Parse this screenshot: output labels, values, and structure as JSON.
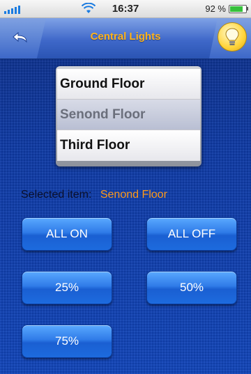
{
  "status_bar": {
    "time": "16:37",
    "battery_text": "92 %",
    "battery_level": 0.92
  },
  "nav": {
    "title": "Central Lights"
  },
  "picker": {
    "items": [
      "Ground Floor",
      "Senond Floor",
      "Third Floor"
    ],
    "selected_index": 1
  },
  "selection": {
    "label": "Selected item:",
    "value": "Senond Floor"
  },
  "buttons": {
    "all_on": "ALL ON",
    "all_off": "ALL OFF",
    "pct_25": "25%",
    "pct_50": "50%",
    "pct_75": "75%"
  },
  "colors": {
    "accent_orange": "#ff9a1a",
    "button_blue": "#2f7be8",
    "background_blue": "#0e3aa5"
  }
}
